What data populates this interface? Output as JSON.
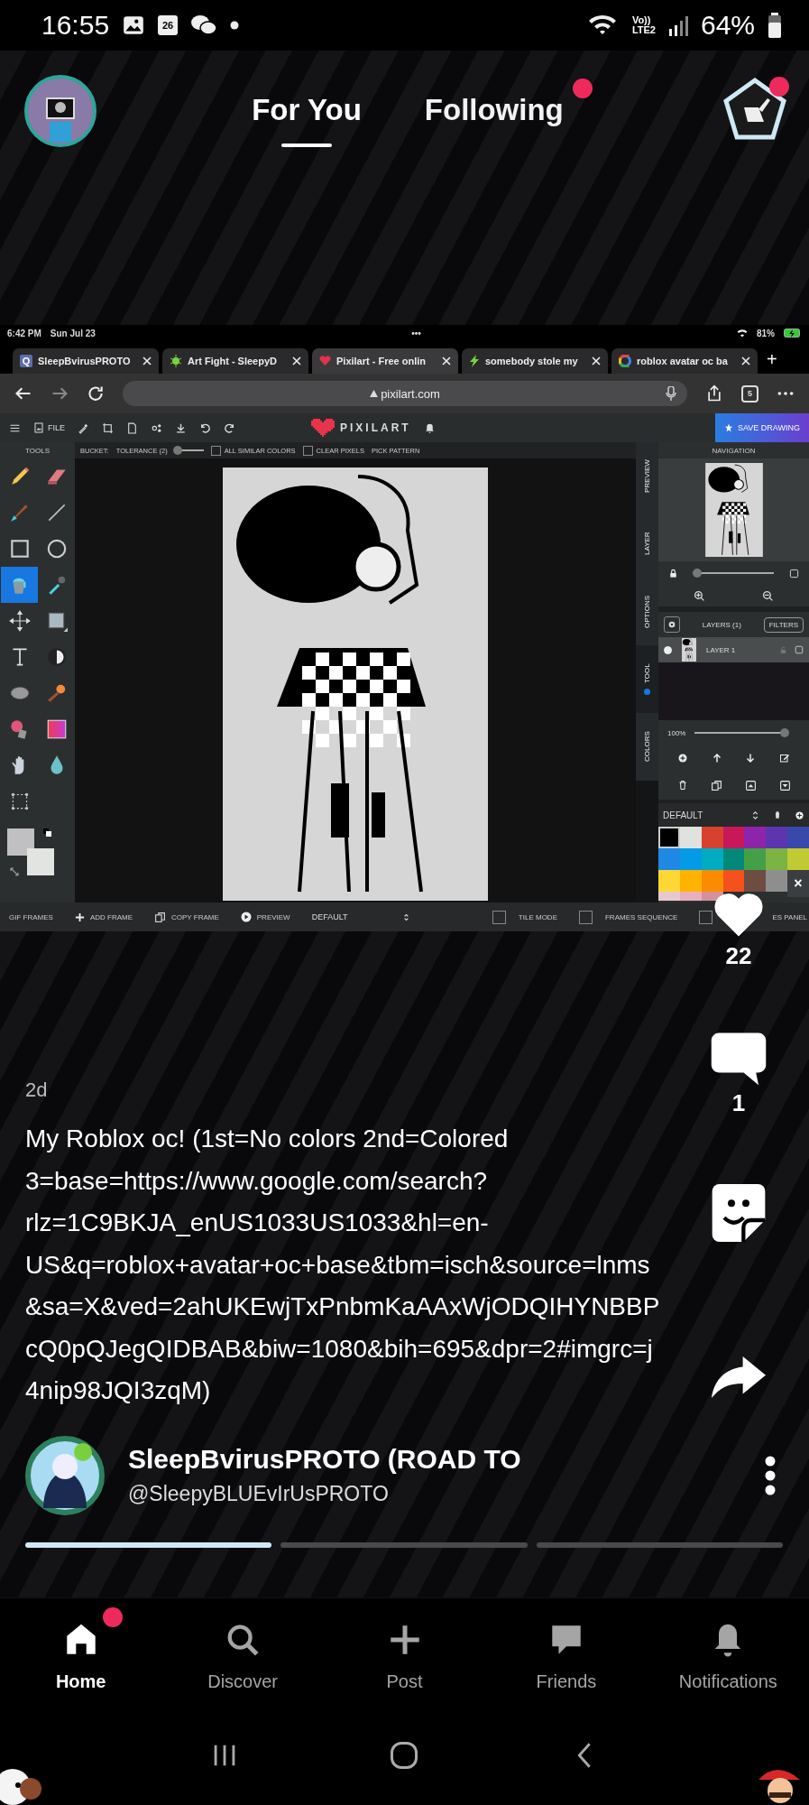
{
  "status_bar": {
    "time": "16:55",
    "calendar_day": "26",
    "network_top": "Vo))",
    "network_bottom": "LTE2",
    "battery": "64%"
  },
  "header": {
    "tabs": [
      {
        "label": "For You",
        "selected": true,
        "notification_dot": false
      },
      {
        "label": "Following",
        "selected": false,
        "notification_dot": true
      }
    ],
    "badge_dot": true
  },
  "screenshot": {
    "device_status": {
      "time": "6:42 PM",
      "date": "Sun Jul 23",
      "more": "•••",
      "battery": "81%"
    },
    "tabs": [
      {
        "title": "SleepBvirusPROTO",
        "kind": "letter",
        "favicon": "Q",
        "selected": false
      },
      {
        "title": "Art Fight - SleepyD",
        "kind": "bug",
        "selected": false
      },
      {
        "title": "Pixilart - Free onlin",
        "kind": "heart",
        "selected": true
      },
      {
        "title": "somebody stole my",
        "kind": "bolt",
        "selected": false
      },
      {
        "title": "roblox avatar oc ba",
        "kind": "google",
        "selected": false
      }
    ],
    "new_tab": "+",
    "url": "pixilart.com",
    "tab_count": "5",
    "toolbar": {
      "file": "FILE",
      "logo": "PIXILART",
      "save": "SAVE DRAWING"
    },
    "tools_title": "TOOLS",
    "tools": [
      {
        "kind": "pencil",
        "selected": false
      },
      {
        "kind": "eraser",
        "selected": false
      },
      {
        "kind": "brush",
        "selected": false
      },
      {
        "kind": "line",
        "selected": false
      },
      {
        "kind": "rectangle",
        "selected": false
      },
      {
        "kind": "ellipse",
        "selected": false
      },
      {
        "kind": "bucket",
        "selected": true
      },
      {
        "kind": "eyedropper",
        "selected": false
      },
      {
        "kind": "move",
        "selected": false
      },
      {
        "kind": "shape",
        "selected": false
      },
      {
        "kind": "text",
        "selected": false
      },
      {
        "kind": "lighten",
        "selected": false
      },
      {
        "kind": "dither",
        "selected": false
      },
      {
        "kind": "stamp",
        "selected": false
      },
      {
        "kind": "smudge",
        "selected": false
      },
      {
        "kind": "gradient",
        "selected": false
      },
      {
        "kind": "hand",
        "selected": false
      },
      {
        "kind": "drop",
        "selected": false
      },
      {
        "kind": "select",
        "selected": false
      }
    ],
    "options": {
      "tool": "BUCKET:",
      "tolerance": "TOLERANCE (2)",
      "tolerance_slider": {
        "level": 0.1
      },
      "checkboxes": [
        {
          "label": "ALL SIMILAR COLORS",
          "checked": false
        },
        {
          "label": "CLEAR PIXELS",
          "checked": false
        }
      ],
      "pick_pattern": "PICK PATTERN"
    },
    "side_tabs": [
      {
        "label": "PREVIEW",
        "selected": false
      },
      {
        "label": "LAYER",
        "selected": false
      },
      {
        "label": "OPTIONS",
        "selected": false
      },
      {
        "label": "TOOL",
        "selected": true
      },
      {
        "label": "COLORS",
        "selected": false
      }
    ],
    "navigation": {
      "title": "NAVIGATION",
      "zoom_slider": {
        "level": 0.05
      }
    },
    "layers": {
      "title": "LAYERS (1)",
      "filters": "FILTERS",
      "items": [
        {
          "name": "LAYER 1",
          "selected": true,
          "visible": true
        }
      ],
      "opacity": "100%",
      "opacity_slider": {
        "level": 1
      }
    },
    "palette": {
      "name": "DEFAULT",
      "close": "×",
      "colors": [
        {
          "color": "#000000",
          "selected": true
        },
        {
          "color": "#e0e2e0",
          "selected": false
        },
        {
          "color": "#d9412f",
          "selected": false
        },
        {
          "color": "#c8185a",
          "selected": false
        },
        {
          "color": "#8e24aa",
          "selected": false
        },
        {
          "color": "#5e35b1",
          "selected": false
        },
        {
          "color": "#3949ab",
          "selected": false
        },
        {
          "color": "#1e88e5",
          "selected": false
        },
        {
          "color": "#039be5",
          "selected": false
        },
        {
          "color": "#00acc1",
          "selected": false
        },
        {
          "color": "#00897b",
          "selected": false
        },
        {
          "color": "#43a047",
          "selected": false
        },
        {
          "color": "#7cb342",
          "selected": false
        },
        {
          "color": "#c0ca33",
          "selected": false
        },
        {
          "color": "#fdd835",
          "selected": false
        },
        {
          "color": "#ffb300",
          "selected": false
        },
        {
          "color": "#fb8c00",
          "selected": false
        },
        {
          "color": "#f4511e",
          "selected": false
        },
        {
          "color": "#6d4c41",
          "selected": false
        },
        {
          "color": "#8e8e8e",
          "selected": false
        },
        {
          "color": "#e8c8d0",
          "selected": false
        },
        {
          "color": "#e6b0be",
          "selected": false
        },
        {
          "color": "#d6909b",
          "selected": false
        }
      ]
    },
    "bottom_bar": {
      "gif_frames": "GIF FRAMES",
      "add_frame": "ADD FRAME",
      "copy_frame": "COPY FRAME",
      "preview": "PREVIEW",
      "frame_mode": "DEFAULT",
      "checkboxes": [
        {
          "label": "TILE MODE",
          "checked": false
        },
        {
          "label": "FRAMES SEQUENCE",
          "checked": false
        },
        {
          "label": "ES PANEL",
          "checked": false
        }
      ]
    }
  },
  "post": {
    "age": "2d",
    "caption": "My Roblox oc! (1st=No colors 2nd=Colored 3=base=https://www.google.com/search?rlz=1C9BKJA_enUS1033US1033&hl=en-US&q=roblox+avatar+oc+base&tbm=isch&source=lnms&sa=X&ved=2ahUKEwjTxPnbmKaAAxWjODQIHYNBBPcQ0pQJegQIDBAB&biw=1080&bih=695&dpr=2#imgrc=j4nip98JQI3zqM)",
    "author_name": "SleepBvirusPROTO (ROAD TO",
    "author_handle": "@SleepyBLUEvIrUsPROTO",
    "slides": [
      {
        "selected": true
      },
      {
        "selected": false
      },
      {
        "selected": false
      }
    ]
  },
  "actions": {
    "likes": "22",
    "comments": "1"
  },
  "nav": [
    {
      "label": "Home",
      "kind": "home",
      "selected": true,
      "notification_dot": true
    },
    {
      "label": "Discover",
      "kind": "search",
      "selected": false,
      "notification_dot": false
    },
    {
      "label": "Post",
      "kind": "plus",
      "selected": false,
      "notification_dot": false
    },
    {
      "label": "Friends",
      "kind": "chat",
      "selected": false,
      "notification_dot": false
    },
    {
      "label": "Notifications",
      "kind": "bell",
      "selected": false,
      "notification_dot": false
    }
  ]
}
